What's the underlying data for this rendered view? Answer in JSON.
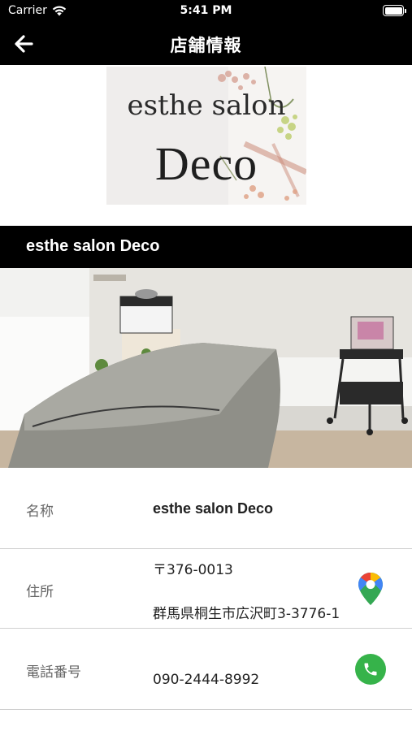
{
  "status_bar": {
    "carrier": "Carrier",
    "time": "5:41 PM"
  },
  "nav": {
    "title": "店舗情報"
  },
  "logo": {
    "line1": "esthe salon",
    "line2": "Deco"
  },
  "section": {
    "title": "esthe salon Deco"
  },
  "info": {
    "name_label": "名称",
    "name_value": "esthe salon Deco",
    "address_label": "住所",
    "postal_code": "〒376-0013",
    "address": "群馬県桐生市広沢町3-3776-1",
    "phone_label": "電話番号",
    "phone": "090-2444-8992"
  },
  "colors": {
    "header_bg": "#000000",
    "phone_button": "#36b34a",
    "divider": "#cfcfcf"
  },
  "icons": {
    "back": "arrow-left-icon",
    "map": "google-maps-pin-icon",
    "phone": "phone-icon",
    "wifi": "wifi-icon",
    "battery": "battery-icon"
  }
}
